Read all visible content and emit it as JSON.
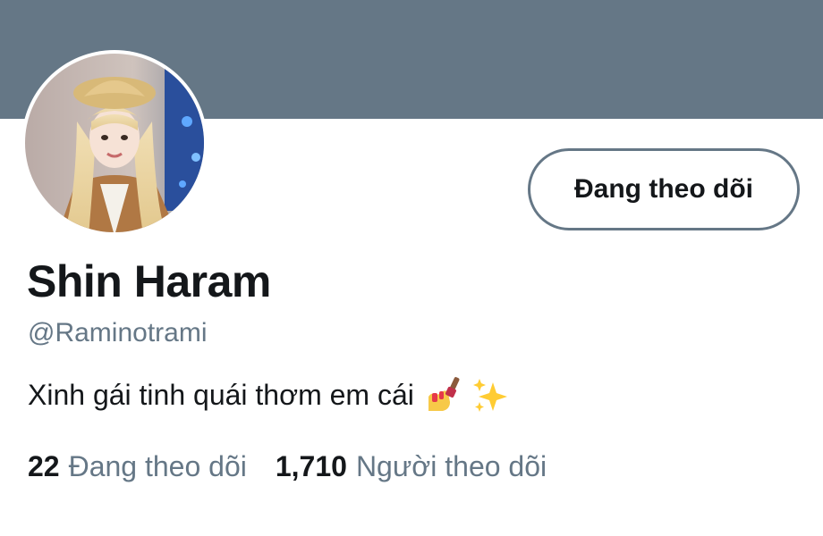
{
  "profile": {
    "name": "Shin Haram",
    "handle": "@Raminotrami",
    "bio": "Xinh gái tinh quái thơm em cái",
    "follow_button_label": "Đang theo dõi"
  },
  "stats": {
    "following_count": "22",
    "following_label": "Đang theo dõi",
    "followers_count": "1,710",
    "followers_label": "Người theo dõi"
  },
  "icons": {
    "bio_emoji_1": "nail-polish-icon",
    "bio_emoji_2": "sparkles-icon"
  },
  "colors": {
    "banner": "#657786",
    "text_primary": "#14171a",
    "text_secondary": "#657786",
    "background": "#ffffff"
  }
}
